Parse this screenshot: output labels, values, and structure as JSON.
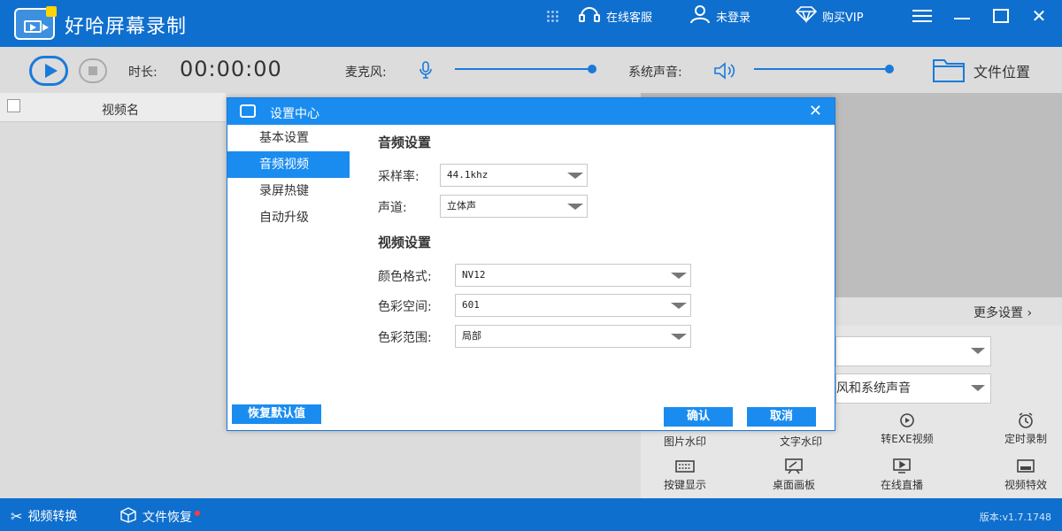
{
  "app": {
    "title": "好哈屏幕录制",
    "header": {
      "support": "在线客服",
      "login": "未登录",
      "buy_vip": "购买VIP"
    }
  },
  "toolbar": {
    "duration_label": "时长:",
    "duration_value": "00:00:00",
    "mic_label": "麦克风:",
    "system_sound_label": "系统声音:",
    "file_location": "文件位置"
  },
  "list": {
    "column_name": "视频名"
  },
  "right_panel": {
    "more_settings": "更多设置",
    "audio_source_partial": "风和系统声音",
    "tools": [
      {
        "label": "图片水印",
        "icon": "image-watermark-icon"
      },
      {
        "label": "文字水印",
        "icon": "text-watermark-icon"
      },
      {
        "label": "转EXE视频",
        "icon": "exe-convert-icon"
      },
      {
        "label": "定时录制",
        "icon": "timer-icon"
      },
      {
        "label": "按键显示",
        "icon": "keyboard-icon"
      },
      {
        "label": "桌面画板",
        "icon": "drawing-board-icon"
      },
      {
        "label": "在线直播",
        "icon": "live-icon"
      },
      {
        "label": "视频特效",
        "icon": "video-effect-icon"
      }
    ]
  },
  "statusbar": {
    "video_convert": "视频转换",
    "file_recover": "文件恢复",
    "version": "版本:v1.7.1748"
  },
  "dialog": {
    "title": "设置中心",
    "nav": [
      "基本设置",
      "音频视频",
      "录屏热键",
      "自动升级"
    ],
    "active_nav": "音频视频",
    "audio": {
      "section_title": "音频设置",
      "sample_rate_label": "采样率:",
      "sample_rate_value": "44.1khz",
      "channel_label": "声道:",
      "channel_value": "立体声"
    },
    "video": {
      "section_title": "视频设置",
      "color_format_label": "颜色格式:",
      "color_format_value": "NV12",
      "color_space_label": "色彩空间:",
      "color_space_value": "601",
      "color_range_label": "色彩范围:",
      "color_range_value": "局部"
    },
    "buttons": {
      "restore_default": "恢复默认值",
      "confirm": "确认",
      "cancel": "取消"
    }
  },
  "colors": {
    "brand_blue": "#0f6fce",
    "accent_blue": "#1a8cf0"
  }
}
